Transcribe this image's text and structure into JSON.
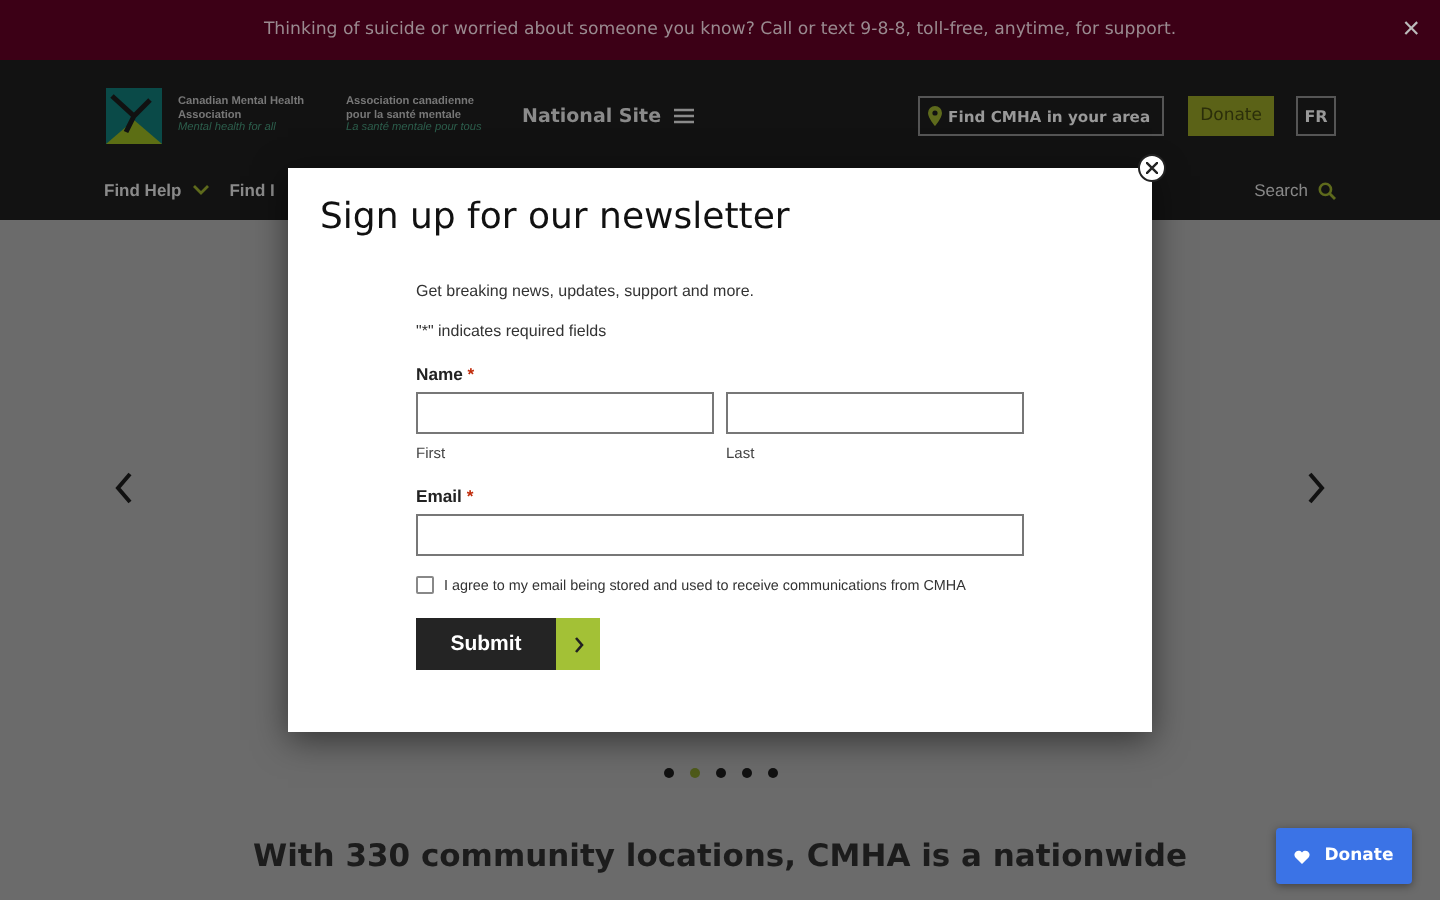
{
  "banner": {
    "text": "Thinking of suicide or worried about someone you know? Call or text 9-8-8, toll-free, anytime, for support.",
    "close": "×"
  },
  "header": {
    "logo": {
      "en_name": "Canadian Mental Health Association",
      "en_tagline": "Mental health for all",
      "fr_name": "Association canadienne pour la santé mentale",
      "fr_tagline": "La santé mentale pour tous"
    },
    "site_menu": "National Site",
    "find_local": "Find CMHA in your area",
    "donate": "Donate",
    "language": "FR",
    "nav": [
      {
        "label": "Find Help",
        "dropdown": true
      },
      {
        "label": "Find I",
        "dropdown": false
      }
    ],
    "search": "Search"
  },
  "carousel": {
    "dots": [
      {
        "selected": false
      },
      {
        "selected": true
      },
      {
        "selected": false
      },
      {
        "selected": false
      },
      {
        "selected": false
      }
    ]
  },
  "intro": "With 330 community locations, CMHA is a nationwide",
  "modal": {
    "title": "Sign up for our newsletter",
    "description": "Get breaking news, updates, support and more.",
    "required_note": "\"*\" indicates required fields",
    "fields": [
      {
        "kind": "split",
        "label": "Name",
        "required_mark": "*",
        "sublabels": [
          "First",
          "Last"
        ]
      },
      {
        "kind": "single",
        "label": "Email",
        "required_mark": "*"
      }
    ],
    "consent": {
      "label": "I agree to my email being stored and used to receive communications from CMHA",
      "checked": false
    },
    "submit": "Submit"
  },
  "floating_donate": "Donate"
}
